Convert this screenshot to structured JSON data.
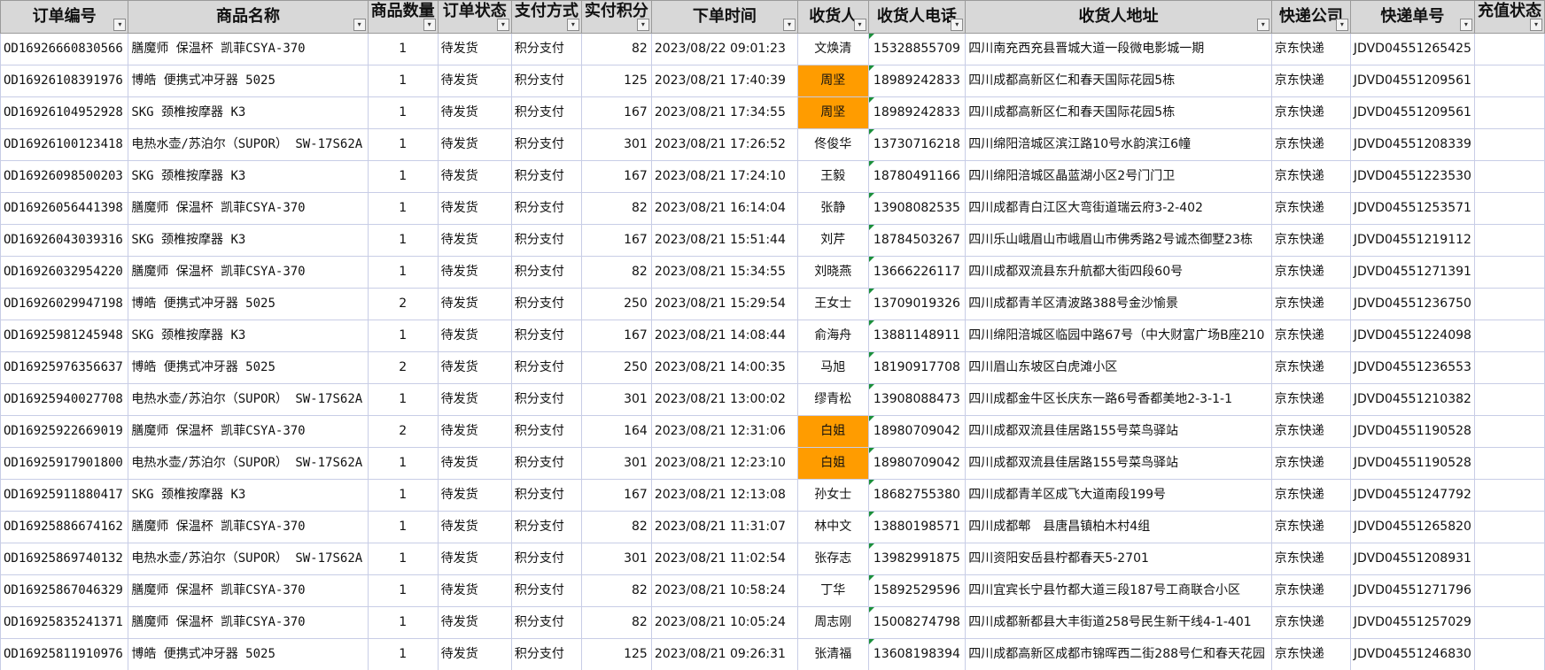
{
  "headers": [
    "订单编号",
    "商品名称",
    "商品数量",
    "订单状态",
    "支付方式",
    "实付积分",
    "下单时间",
    "收货人",
    "收货人电话",
    "收货人地址",
    "快递公司",
    "快递单号",
    "充值状态"
  ],
  "highlight_color": "#ff9c00",
  "filter_icon": "filter-dropdown-icon",
  "rows": [
    {
      "id": "OD16926660830566",
      "product": "膳魔师 保温杯 凯菲CSYA-370",
      "qty": "1",
      "status": "待发货",
      "pay": "积分支付",
      "points": "82",
      "time": "2023/08/22 09:01:23",
      "name": "文焕清",
      "highlight": false,
      "phone": "15328855709",
      "addr": "四川南充西充县晋城大道一段微电影城一期",
      "courier": "京东快递",
      "tracking": "JDVD04551265425",
      "recharge": ""
    },
    {
      "id": "OD16926108391976",
      "product": "博皓 便携式冲牙器 5025",
      "qty": "1",
      "status": "待发货",
      "pay": "积分支付",
      "points": "125",
      "time": "2023/08/21 17:40:39",
      "name": "周坚",
      "highlight": true,
      "phone": "18989242833",
      "addr": "四川成都高新区仁和春天国际花园5栋",
      "courier": "京东快递",
      "tracking": "JDVD04551209561",
      "recharge": ""
    },
    {
      "id": "OD16926104952928",
      "product": "SKG 颈椎按摩器 K3",
      "qty": "1",
      "status": "待发货",
      "pay": "积分支付",
      "points": "167",
      "time": "2023/08/21 17:34:55",
      "name": "周坚",
      "highlight": true,
      "phone": "18989242833",
      "addr": "四川成都高新区仁和春天国际花园5栋",
      "courier": "京东快递",
      "tracking": "JDVD04551209561",
      "recharge": ""
    },
    {
      "id": "OD16926100123418",
      "product": "电热水壶/苏泊尔（SUPOR） SW-17S62A",
      "qty": "1",
      "status": "待发货",
      "pay": "积分支付",
      "points": "301",
      "time": "2023/08/21 17:26:52",
      "name": "佟俊华",
      "highlight": false,
      "phone": "13730716218",
      "addr": "四川绵阳涪城区滨江路10号水韵滨江6幢",
      "courier": "京东快递",
      "tracking": "JDVD04551208339",
      "recharge": ""
    },
    {
      "id": "OD16926098500203",
      "product": "SKG 颈椎按摩器 K3",
      "qty": "1",
      "status": "待发货",
      "pay": "积分支付",
      "points": "167",
      "time": "2023/08/21 17:24:10",
      "name": "王毅",
      "highlight": false,
      "phone": "18780491166",
      "addr": "四川绵阳涪城区晶蓝湖小区2号门门卫",
      "courier": "京东快递",
      "tracking": "JDVD04551223530",
      "recharge": ""
    },
    {
      "id": "OD16926056441398",
      "product": "膳魔师 保温杯 凯菲CSYA-370",
      "qty": "1",
      "status": "待发货",
      "pay": "积分支付",
      "points": "82",
      "time": "2023/08/21 16:14:04",
      "name": "张静",
      "highlight": false,
      "phone": "13908082535",
      "addr": "四川成都青白江区大弯街道瑞云府3-2-402",
      "courier": "京东快递",
      "tracking": "JDVD04551253571",
      "recharge": ""
    },
    {
      "id": "OD16926043039316",
      "product": "SKG 颈椎按摩器 K3",
      "qty": "1",
      "status": "待发货",
      "pay": "积分支付",
      "points": "167",
      "time": "2023/08/21 15:51:44",
      "name": "刘芹",
      "highlight": false,
      "phone": "18784503267",
      "addr": "四川乐山峨眉山市峨眉山市佛秀路2号诚杰御墅23栋",
      "courier": "京东快递",
      "tracking": "JDVD04551219112",
      "recharge": ""
    },
    {
      "id": "OD16926032954220",
      "product": "膳魔师 保温杯 凯菲CSYA-370",
      "qty": "1",
      "status": "待发货",
      "pay": "积分支付",
      "points": "82",
      "time": "2023/08/21 15:34:55",
      "name": "刘晓燕",
      "highlight": false,
      "phone": "13666226117",
      "addr": "四川成都双流县东升航都大街四段60号",
      "courier": "京东快递",
      "tracking": "JDVD04551271391",
      "recharge": ""
    },
    {
      "id": "OD16926029947198",
      "product": "博皓 便携式冲牙器 5025",
      "qty": "2",
      "status": "待发货",
      "pay": "积分支付",
      "points": "250",
      "time": "2023/08/21 15:29:54",
      "name": "王女士",
      "highlight": false,
      "phone": "13709019326",
      "addr": "四川成都青羊区清波路388号金沙愉景",
      "courier": "京东快递",
      "tracking": "JDVD04551236750",
      "recharge": ""
    },
    {
      "id": "OD16925981245948",
      "product": "SKG 颈椎按摩器 K3",
      "qty": "1",
      "status": "待发货",
      "pay": "积分支付",
      "points": "167",
      "time": "2023/08/21 14:08:44",
      "name": "俞海舟",
      "highlight": false,
      "phone": "13881148911",
      "addr": "四川绵阳涪城区临园中路67号（中大财富广场B座210",
      "courier": "京东快递",
      "tracking": "JDVD04551224098",
      "recharge": ""
    },
    {
      "id": "OD16925976356637",
      "product": "博皓 便携式冲牙器 5025",
      "qty": "2",
      "status": "待发货",
      "pay": "积分支付",
      "points": "250",
      "time": "2023/08/21 14:00:35",
      "name": "马旭",
      "highlight": false,
      "phone": "18190917708",
      "addr": "四川眉山东坡区白虎滩小区",
      "courier": "京东快递",
      "tracking": "JDVD04551236553",
      "recharge": ""
    },
    {
      "id": "OD16925940027708",
      "product": "电热水壶/苏泊尔（SUPOR） SW-17S62A",
      "qty": "1",
      "status": "待发货",
      "pay": "积分支付",
      "points": "301",
      "time": "2023/08/21 13:00:02",
      "name": "缪青松",
      "highlight": false,
      "phone": "13908088473",
      "addr": "四川成都金牛区长庆东一路6号香都美地2-3-1-1",
      "courier": "京东快递",
      "tracking": "JDVD04551210382",
      "recharge": ""
    },
    {
      "id": "OD16925922669019",
      "product": "膳魔师 保温杯 凯菲CSYA-370",
      "qty": "2",
      "status": "待发货",
      "pay": "积分支付",
      "points": "164",
      "time": "2023/08/21 12:31:06",
      "name": "白姐",
      "highlight": true,
      "phone": "18980709042",
      "addr": "四川成都双流县佳居路155号菜鸟驿站",
      "courier": "京东快递",
      "tracking": "JDVD04551190528",
      "recharge": ""
    },
    {
      "id": "OD16925917901800",
      "product": "电热水壶/苏泊尔（SUPOR） SW-17S62A",
      "qty": "1",
      "status": "待发货",
      "pay": "积分支付",
      "points": "301",
      "time": "2023/08/21 12:23:10",
      "name": "白姐",
      "highlight": true,
      "phone": "18980709042",
      "addr": "四川成都双流县佳居路155号菜鸟驿站",
      "courier": "京东快递",
      "tracking": "JDVD04551190528",
      "recharge": ""
    },
    {
      "id": "OD16925911880417",
      "product": "SKG 颈椎按摩器 K3",
      "qty": "1",
      "status": "待发货",
      "pay": "积分支付",
      "points": "167",
      "time": "2023/08/21 12:13:08",
      "name": "孙女士",
      "highlight": false,
      "phone": "18682755380",
      "addr": "四川成都青羊区成飞大道南段199号",
      "courier": "京东快递",
      "tracking": "JDVD04551247792",
      "recharge": ""
    },
    {
      "id": "OD16925886674162",
      "product": "膳魔师 保温杯 凯菲CSYA-370",
      "qty": "1",
      "status": "待发货",
      "pay": "积分支付",
      "points": "82",
      "time": "2023/08/21 11:31:07",
      "name": "林中文",
      "highlight": false,
      "phone": "13880198571",
      "addr": "四川成都郫　县唐昌镇柏木村4组",
      "courier": "京东快递",
      "tracking": "JDVD04551265820",
      "recharge": ""
    },
    {
      "id": "OD16925869740132",
      "product": "电热水壶/苏泊尔（SUPOR） SW-17S62A",
      "qty": "1",
      "status": "待发货",
      "pay": "积分支付",
      "points": "301",
      "time": "2023/08/21 11:02:54",
      "name": "张存志",
      "highlight": false,
      "phone": "13982991875",
      "addr": "四川资阳安岳县柠都春天5-2701",
      "courier": "京东快递",
      "tracking": "JDVD04551208931",
      "recharge": ""
    },
    {
      "id": "OD16925867046329",
      "product": "膳魔师 保温杯 凯菲CSYA-370",
      "qty": "1",
      "status": "待发货",
      "pay": "积分支付",
      "points": "82",
      "time": "2023/08/21 10:58:24",
      "name": "丁华",
      "highlight": false,
      "phone": "15892529596",
      "addr": "四川宜宾长宁县竹都大道三段187号工商联合小区",
      "courier": "京东快递",
      "tracking": "JDVD04551271796",
      "recharge": ""
    },
    {
      "id": "OD16925835241371",
      "product": "膳魔师 保温杯 凯菲CSYA-370",
      "qty": "1",
      "status": "待发货",
      "pay": "积分支付",
      "points": "82",
      "time": "2023/08/21 10:05:24",
      "name": "周志刚",
      "highlight": false,
      "phone": "15008274798",
      "addr": "四川成都新都县大丰街道258号民生新干线4-1-401",
      "courier": "京东快递",
      "tracking": "JDVD04551257029",
      "recharge": ""
    },
    {
      "id": "OD16925811910976",
      "product": "博皓 便携式冲牙器 5025",
      "qty": "1",
      "status": "待发货",
      "pay": "积分支付",
      "points": "125",
      "time": "2023/08/21 09:26:31",
      "name": "张清福",
      "highlight": false,
      "phone": "13608198394",
      "addr": "四川成都高新区成都市锦晖西二街288号仁和春天花园",
      "courier": "京东快递",
      "tracking": "JDVD04551246830",
      "recharge": ""
    }
  ]
}
